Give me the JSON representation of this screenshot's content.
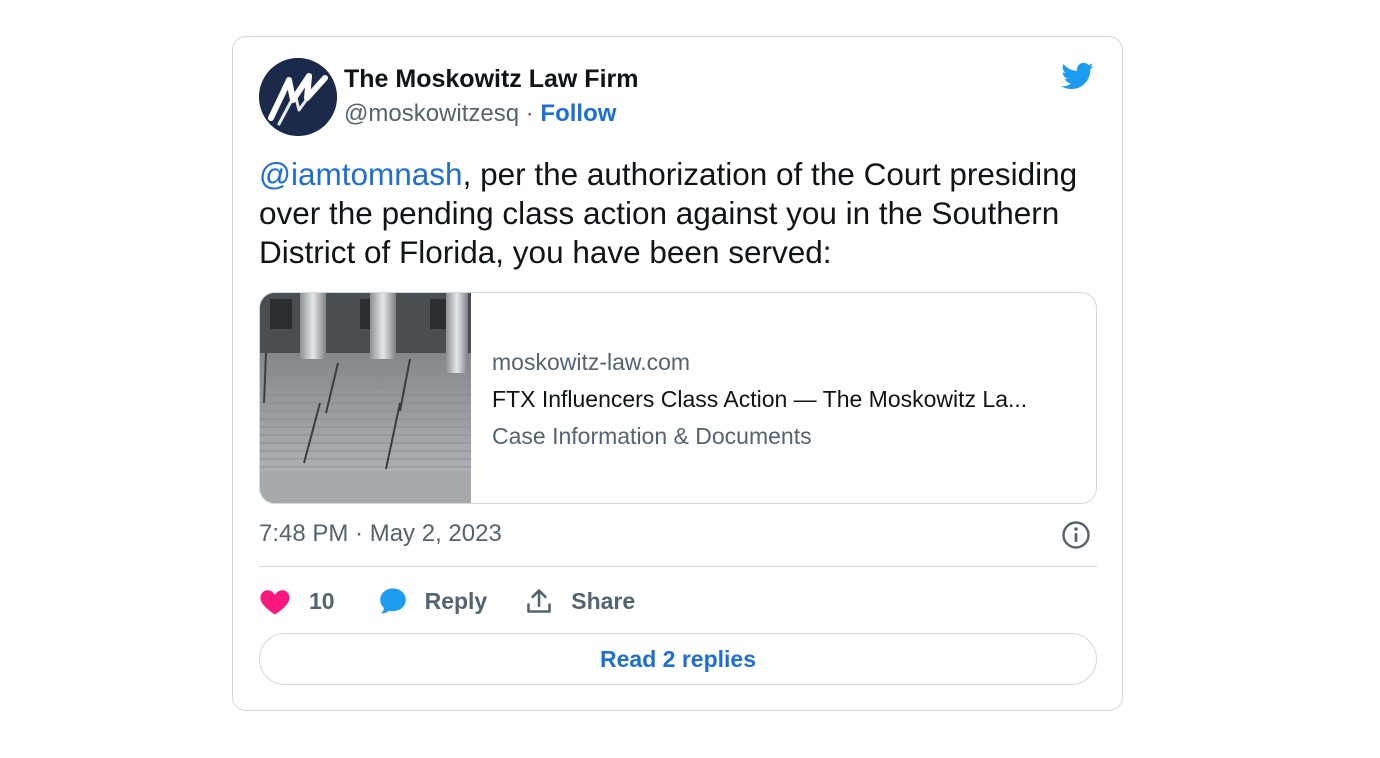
{
  "tweet": {
    "author_name": "The Moskowitz Law Firm",
    "handle": "@moskowitzesq",
    "separator": "·",
    "follow_label": "Follow",
    "mention": "@iamtomnash",
    "body": ", per the authorization of the Court presiding over the pending class action against you in the Southern District of Florida, you have been served:",
    "timestamp": "7:48 PM · May 2, 2023",
    "link_card": {
      "domain": "moskowitz-law.com",
      "title": "FTX Influencers Class Action — The Moskowitz La...",
      "description": "Case Information & Documents"
    },
    "likes_count": "10",
    "reply_label": "Reply",
    "share_label": "Share",
    "read_replies_label": "Read 2 replies"
  },
  "icons": {
    "brand": "twitter-bird-icon",
    "like": "heart-icon",
    "reply": "speech-bubble-icon",
    "share": "share-upload-icon",
    "info": "info-icon"
  },
  "colors": {
    "link_blue": "#1d6ed8",
    "twitter_blue": "#1d9bf0",
    "heart_pink": "#f91880",
    "avatar_navy": "#1b2a4a",
    "muted_text": "#536471",
    "border": "#cfd9de"
  }
}
